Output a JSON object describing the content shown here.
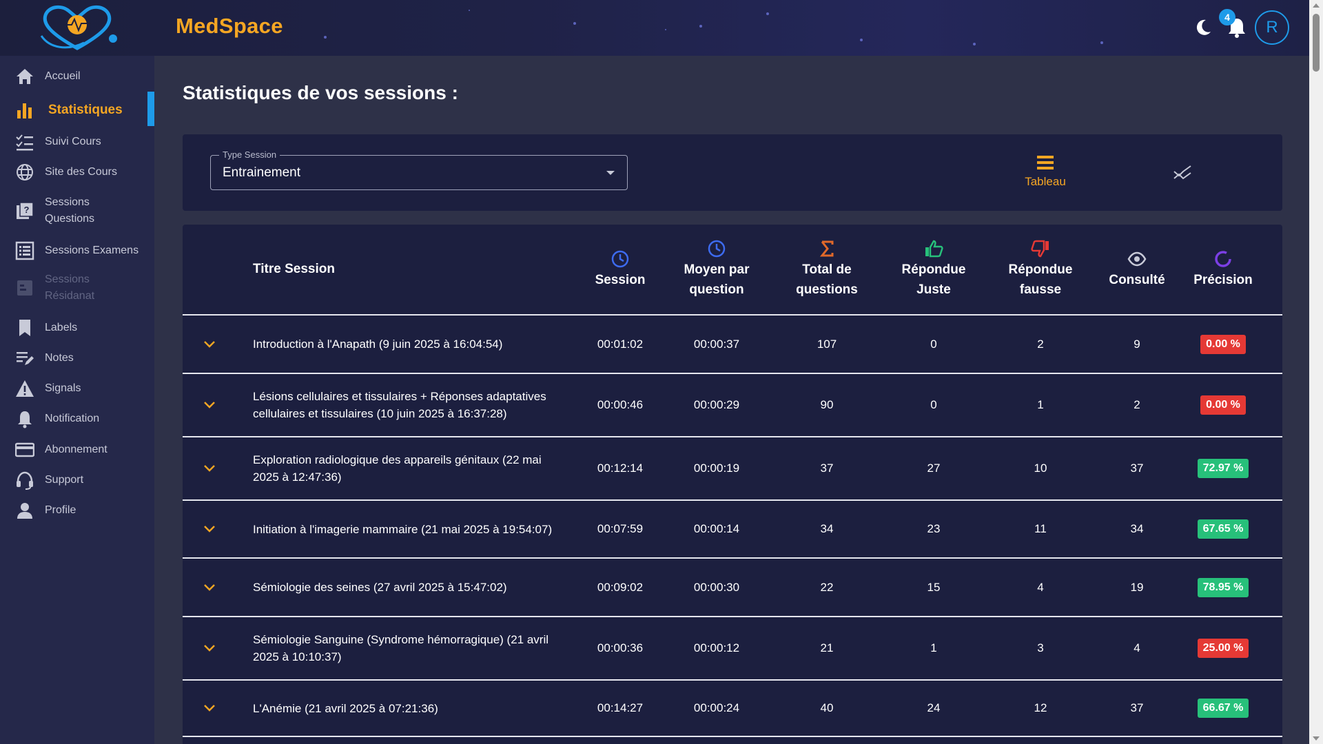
{
  "app": {
    "brand": "MedSpace",
    "notification_count": "4",
    "avatar_initial": "R"
  },
  "sidebar": {
    "items": [
      {
        "label": "Accueil",
        "icon": "home-icon"
      },
      {
        "label": "Statistiques",
        "icon": "bar-chart-icon",
        "active": true
      },
      {
        "label": "Suivi Cours",
        "icon": "checklist-icon"
      },
      {
        "label": "Site des Cours",
        "icon": "globe-icon"
      },
      {
        "label": "Sessions\nQuestions",
        "icon": "question-book-icon"
      },
      {
        "label": "Sessions Examens",
        "icon": "list-icon"
      },
      {
        "label": "Sessions\nRésidanat",
        "icon": "document-icon",
        "disabled": true
      },
      {
        "label": "Labels",
        "icon": "bookmark-icon"
      },
      {
        "label": "Notes",
        "icon": "edit-note-icon"
      },
      {
        "label": "Signals",
        "icon": "warning-icon"
      },
      {
        "label": "Notification",
        "icon": "bell-icon"
      },
      {
        "label": "Abonnement",
        "icon": "credit-card-icon"
      },
      {
        "label": "Support",
        "icon": "headset-icon"
      },
      {
        "label": "Profile",
        "icon": "person-icon"
      }
    ]
  },
  "main": {
    "title": "Statistiques de vos sessions :",
    "filter": {
      "legend": "Type Session",
      "value": "Entrainement"
    },
    "views": {
      "table_label": "Tableau"
    }
  },
  "colors": {
    "accent": "#f5a623",
    "blue": "#1e9be9",
    "red": "#e53935",
    "green": "#27c07a"
  },
  "table": {
    "headers": {
      "title": "Titre Session",
      "session": "Session",
      "avg": [
        "Moyen par",
        "question"
      ],
      "total": [
        "Total de",
        "questions"
      ],
      "right": [
        "Répondue",
        "Juste"
      ],
      "wrong": [
        "Répondue",
        "fausse"
      ],
      "viewed": "Consulté",
      "precision": "Précision"
    },
    "rows": [
      {
        "title": [
          "Introduction à l'Anapath (9 juin 2025 à 16:04:54)"
        ],
        "session": "00:01:02",
        "avg": "00:00:37",
        "total": "107",
        "right": "0",
        "wrong": "2",
        "viewed": "9",
        "precision": "0.00 %",
        "status": "red"
      },
      {
        "title": [
          "Lésions cellulaires et tissulaires + Réponses adaptatives",
          "cellulaires et tissulaires (10 juin 2025 à 16:37:28)"
        ],
        "session": "00:00:46",
        "avg": "00:00:29",
        "total": "90",
        "right": "0",
        "wrong": "1",
        "viewed": "2",
        "precision": "0.00 %",
        "status": "red"
      },
      {
        "title": [
          "Exploration radiologique des appareils génitaux (22 mai",
          "2025 à 12:47:36)"
        ],
        "session": "00:12:14",
        "avg": "00:00:19",
        "total": "37",
        "right": "27",
        "wrong": "10",
        "viewed": "37",
        "precision": "72.97 %",
        "status": "green"
      },
      {
        "title": [
          "Initiation à l'imagerie mammaire (21 mai 2025 à 19:54:07)"
        ],
        "session": "00:07:59",
        "avg": "00:00:14",
        "total": "34",
        "right": "23",
        "wrong": "11",
        "viewed": "34",
        "precision": "67.65 %",
        "status": "green"
      },
      {
        "title": [
          "Sémiologie des seines (27 avril 2025 à 15:47:02)"
        ],
        "session": "00:09:02",
        "avg": "00:00:30",
        "total": "22",
        "right": "15",
        "wrong": "4",
        "viewed": "19",
        "precision": "78.95 %",
        "status": "green"
      },
      {
        "title": [
          "Sémiologie Sanguine (Syndrome hémorragique) (21 avril",
          "2025 à 10:10:37)"
        ],
        "session": "00:00:36",
        "avg": "00:00:12",
        "total": "21",
        "right": "1",
        "wrong": "3",
        "viewed": "4",
        "precision": "25.00 %",
        "status": "red"
      },
      {
        "title": [
          "L'Anémie (21 avril 2025 à 07:21:36)"
        ],
        "session": "00:14:27",
        "avg": "00:00:24",
        "total": "40",
        "right": "24",
        "wrong": "12",
        "viewed": "37",
        "precision": "66.67 %",
        "status": "green"
      }
    ]
  }
}
